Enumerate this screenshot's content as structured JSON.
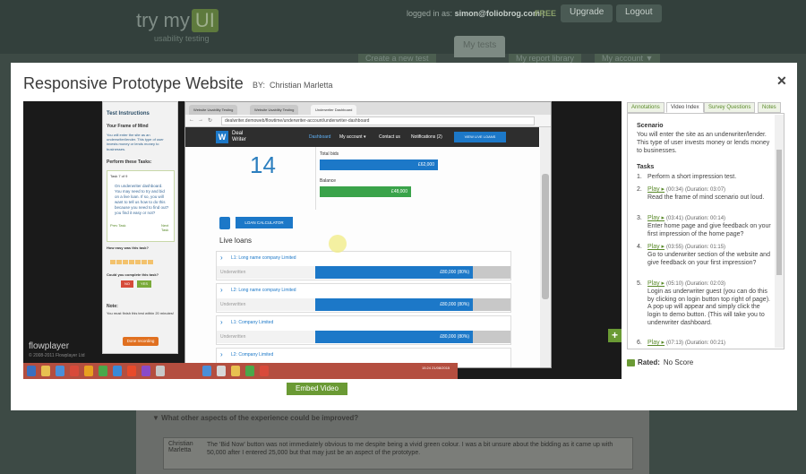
{
  "background": {
    "logo_text": "try my",
    "logo_badge": "UI",
    "tagline": "usability testing",
    "logged_in_as_label": "logged in as:",
    "user_email": "simon@foliobrog.com",
    "separator": "|",
    "plan": "FREE",
    "upgrade_label": "Upgrade",
    "logout_label": "Logout",
    "tab_my_tests": "My tests",
    "subnav": [
      "Create a new test",
      "My report library",
      "My account ▼"
    ],
    "question": "What other aspects of the experience could be improved?",
    "answer_author": "Christian Marletta",
    "answer_text": "The 'Bid Now' button was not immediately obvious to me despite being a vivid green colour. I was a bit unsure about the bidding as it came up with 50,000 after I entered 25,000 but that may just be an aspect of the prototype."
  },
  "modal": {
    "title": "Responsive Prototype Website",
    "by_label": "BY:",
    "author": "Christian Marletta",
    "close_glyph": "✕",
    "embed_label": "Embed Video"
  },
  "video": {
    "player_name": "flowplayer",
    "player_copyright": "© 2008-2011 Flowplayer Ltd",
    "instructions": {
      "title": "Test Instructions",
      "frame_heading": "Your Frame of Mind",
      "frame_text": "You will enter the site as an underwriter/lender. This type of user invests money or lends money to businesses.",
      "tasks_heading": "Perform these Tasks:",
      "task_counter": "Task 7 of 9",
      "task_text": "On underwriter dashboard. You may need to try and bid on a live loan. If so, you will want to tell us how to do this because you need to find out? you find it easy or not?",
      "prev_label": "Prev Task",
      "next_label": "Next Task",
      "rate_heading": "How easy was this task?",
      "complete_heading": "Could you complete this task?",
      "no_label": "NO",
      "yes_label": "YES",
      "note_heading": "Note:",
      "note_text": "You must finish this test within 20 minutes!",
      "done_label": "Done recording"
    },
    "browser": {
      "tabs": [
        "Website Usability Testing",
        "Website Usability Testing",
        "Underwriter Dashboard"
      ],
      "url": "dealwriter.demoweb/flowtime/underwriter-account/underwriter-dashboard",
      "site": {
        "logo_glyph": "W",
        "logo_name_1": "Deal",
        "logo_name_2": "Writer",
        "nav": [
          "Dashboard",
          "My account ▾",
          "Contact us",
          "Notifications (2)"
        ],
        "live_loans_btn": "VIEW LIVE LOANS",
        "stat_number": "14",
        "total_bids_label": "Total bids",
        "total_bids_value": "£62,000",
        "balance_label": "Balance",
        "balance_value": "£48,000",
        "calc_label": "LOAN CALCULATOR",
        "live_loans_title": "Live loans",
        "loans": [
          {
            "name": "L1: Long name company Limited",
            "status": "Underwritten",
            "amount": "£80,000 (80%)"
          },
          {
            "name": "L2: Long name company Limited",
            "status": "Underwritten",
            "amount": "£80,000 (80%)"
          },
          {
            "name": "L1: Company Limited",
            "status": "Underwritten",
            "amount": "£80,000 (80%)"
          },
          {
            "name": "L2: Company Limited",
            "status": "Underwritten",
            "amount": "£80,000 (80%)"
          }
        ]
      }
    },
    "taskbar_clock": "15:24 21/08/2015"
  },
  "right_panel": {
    "tabs": [
      "Annotations",
      "Video Index",
      "Survey Questions",
      "Notes"
    ],
    "active_tab": "Video Index",
    "scenario_heading": "Scenario",
    "scenario_text": "You will enter the site as an underwriter/lender. This type of user invests money or lends money to businesses.",
    "tasks_heading": "Tasks",
    "tasks": [
      {
        "num": "1.",
        "play": "",
        "time": "",
        "duration": "",
        "text": "Perform a short impression test."
      },
      {
        "num": "2.",
        "play": "Play ▸",
        "time": "(00:34)",
        "duration": "(Duration: 03:07)",
        "text": "Read the frame of mind scenario out loud."
      },
      {
        "num": "3.",
        "play": "Play ▸",
        "time": "(03:41)",
        "duration": "(Duration: 00:14)",
        "text": "Enter home page and give feedback on your first impression of the home page?"
      },
      {
        "num": "4.",
        "play": "Play ▸",
        "time": "(03:55)",
        "duration": "(Duration: 01:15)",
        "text": "Go to underwriter section of the website and give feedback on your first impression?"
      },
      {
        "num": "5.",
        "play": "Play ▸",
        "time": "(05:10)",
        "duration": "(Duration: 02:03)",
        "text": "Login as underwriter guest (you can do this by clicking on login button top right of page). A pop up will appear and simply click the login to demo button. (This will take you to underwriter dashboard."
      },
      {
        "num": "6.",
        "play": "Play ▸",
        "time": "(07:13)",
        "duration": "(Duration: 00:21)",
        "text": ""
      }
    ],
    "add_glyph": "+",
    "rated_label": "Rated:",
    "rated_value": "No Score"
  }
}
